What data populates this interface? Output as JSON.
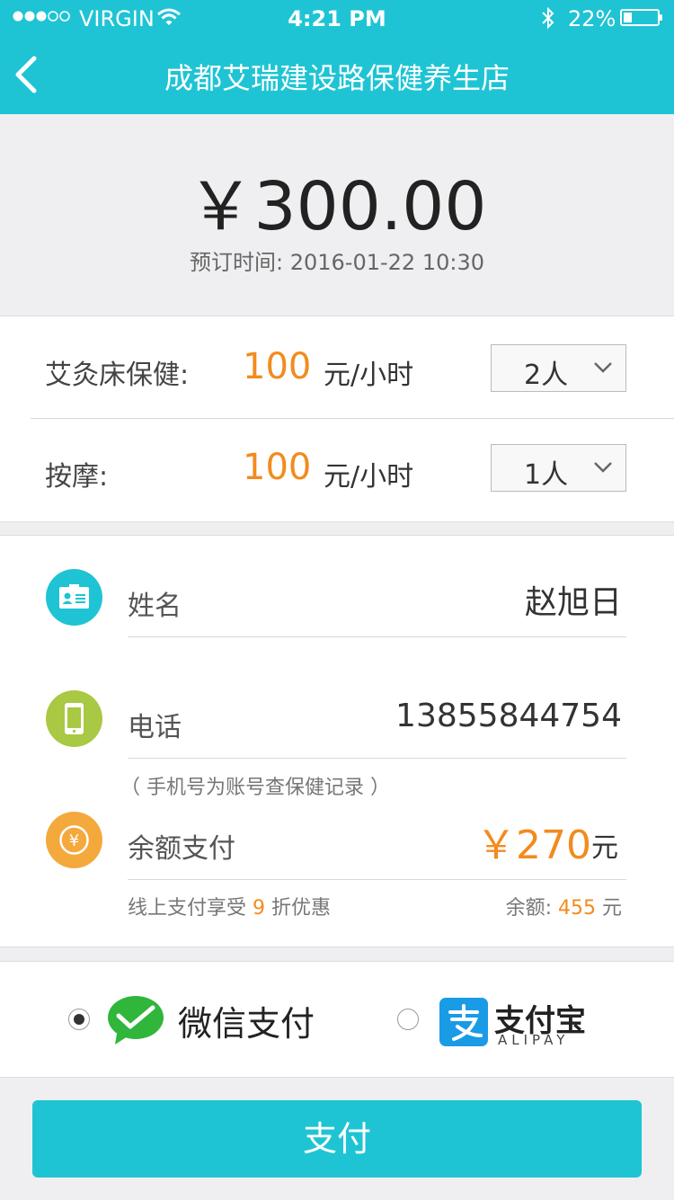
{
  "status_bar": {
    "carrier": "VIRGIN",
    "time": "4:21 PM",
    "battery": "22%"
  },
  "header": {
    "title": "成都艾瑞建设路保健养生店"
  },
  "order": {
    "amount": "￥300.00",
    "booking_label": "预订时间:",
    "booking_time": "2016-01-22 10:30"
  },
  "services": [
    {
      "name": "艾灸床保健:",
      "price": "100",
      "unit": "元/小时",
      "count": "2人"
    },
    {
      "name": "按摩:",
      "price": "100",
      "unit": "元/小时",
      "count": "1人"
    }
  ],
  "contact": {
    "name_label": "姓名",
    "name_value": "赵旭日",
    "phone_label": "电话",
    "phone_value": "13855844754",
    "phone_hint": "（ 手机号为账号查保健记录 ）"
  },
  "balance": {
    "label": "余额支付",
    "amount": "￥270",
    "unit": "元",
    "discount_prefix": "线上支付享受",
    "discount_value": "9",
    "discount_suffix": "折优惠",
    "balance_label": "余额:",
    "balance_value": "455",
    "balance_unit": "元"
  },
  "payment": {
    "wechat_label": "微信支付",
    "wechat_selected": true,
    "alipay_label": "支付宝",
    "alipay_sub": "ALIPAY",
    "alipay_selected": false
  },
  "pay_button": "支付",
  "colors": {
    "accent": "#1fc4d4",
    "price": "#f28b1e",
    "name_icon": "#1fc4d4",
    "phone_icon": "#a9c843",
    "balance_icon": "#f4a93d",
    "wechat": "#2fb63b",
    "alipay": "#1a9be6"
  }
}
